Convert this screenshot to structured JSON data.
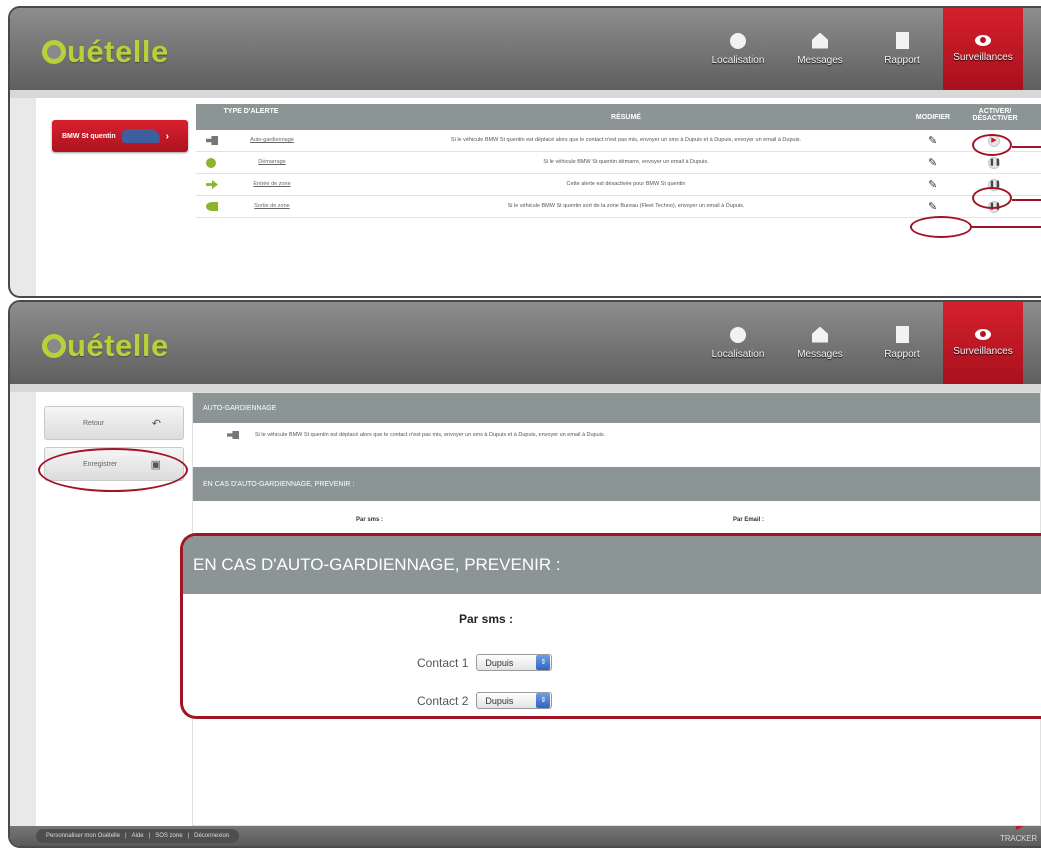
{
  "app": {
    "logo_text": "uételle"
  },
  "nav": [
    {
      "label": "Localisation",
      "icon": "globe-icon"
    },
    {
      "label": "Messages",
      "icon": "house-icon"
    },
    {
      "label": "Rapport",
      "icon": "document-icon"
    },
    {
      "label": "Surveillances",
      "icon": "eye-icon",
      "active": true
    }
  ],
  "screen1": {
    "vehicle_button": "BMW St quentin",
    "table": {
      "headers": {
        "type": "TYPE D'ALERTE",
        "summary": "RÉSUMÉ",
        "edit": "MODIFIER",
        "toggle": "ACTIVER/ DÉSACTIVER"
      },
      "rows": [
        {
          "icon": "key-icon",
          "name": "Auto-gardiennage",
          "summary": "Si le véhicule BMW St quentin est déplacé alors que le contact n'est pas mis, envoyer un sms à Dupuis et à Dupuis, envoyer un email à Dupuis.",
          "state": "play"
        },
        {
          "icon": "plus-circle-icon",
          "name": "Démarrage",
          "summary": "Si le véhicule BMW St quentin démarre, envoyer un email à Dupuis.",
          "state": "pause"
        },
        {
          "icon": "zone-enter-icon",
          "name": "Entrée de zone",
          "summary": "Cette alerte est désactivée pour BMW St quentin",
          "state": "pause"
        },
        {
          "icon": "zone-exit-icon",
          "name": "Sortie de zone",
          "summary": "Si le véhicule BMW St quentin sort de la zone Bureau (Fleet Techno), envoyer un email à Dupuis.",
          "state": "pause"
        }
      ]
    }
  },
  "screen2": {
    "back_button": "Retour",
    "save_button": "Enregistrer",
    "section_title": "AUTO-GARDIENNAGE",
    "section_desc": "Si le véhicule BMW St quentin est déplacé alors que le contact n'est pas mis, envoyer un sms à Dupuis et à Dupuis, envoyer un email à Dupuis.",
    "prevent_title": "EN CAS D'AUTO-GARDIENNAGE, PREVENIR :",
    "by_sms": "Par sms :",
    "by_email": "Par Email :",
    "contacts": [
      {
        "label": "Contact 1",
        "value": "Dupuis"
      },
      {
        "label": "Contact 2",
        "value": "Dupuis"
      }
    ]
  },
  "footer": {
    "links": [
      "Personnaliser mon Ouételle",
      "Aide",
      "SOS zone",
      "Déconnexion"
    ],
    "brand": "TRACKER"
  },
  "colors": {
    "accent": "#b51320",
    "logo": "#b9d03a",
    "header_bar": "#8b9596"
  }
}
